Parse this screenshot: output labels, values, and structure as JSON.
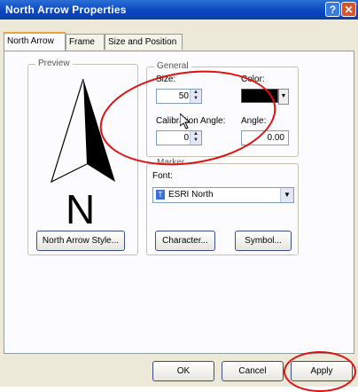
{
  "window": {
    "title": "North Arrow Properties",
    "help_glyph": "?",
    "close_glyph": "✕"
  },
  "tabs": [
    {
      "label": "North Arrow",
      "active": true
    },
    {
      "label": "Frame",
      "active": false
    },
    {
      "label": "Size and Position",
      "active": false
    }
  ],
  "preview": {
    "legend": "Preview",
    "north_letter": "N",
    "style_button": "North Arrow Style..."
  },
  "general": {
    "legend": "General",
    "size_label": "Size:",
    "size_value": "50",
    "color_label": "Color:",
    "color_value": "#000000",
    "calibration_label": "Calibration Angle:",
    "calibration_value": "0",
    "angle_label": "Angle:",
    "angle_value": "0.00"
  },
  "marker": {
    "legend": "Marker",
    "font_label": "Font:",
    "font_value": "ESRI North",
    "character_button": "Character...",
    "symbol_button": "Symbol..."
  },
  "footer": {
    "ok": "OK",
    "cancel": "Cancel",
    "apply": "Apply"
  },
  "colors": {
    "annotation": "#e01010",
    "title_bar": "#0a46c0"
  }
}
